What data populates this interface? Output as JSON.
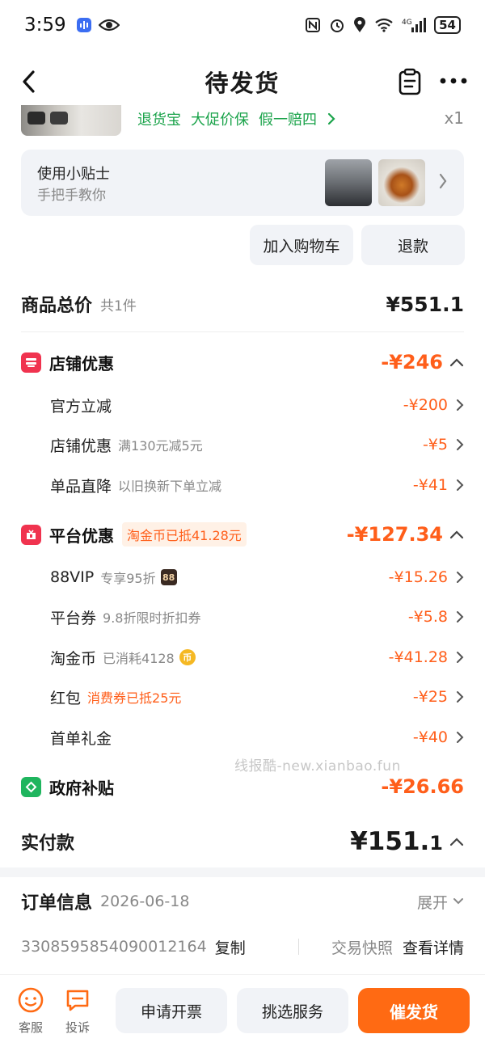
{
  "status_bar": {
    "time": "3:59",
    "network": "4G",
    "battery": "54"
  },
  "nav": {
    "title": "待发货"
  },
  "product": {
    "services": [
      "退货宝",
      "大促价保",
      "假一赔四"
    ],
    "quantity": "x1"
  },
  "tips": {
    "title": "使用小贴士",
    "subtitle": "手把手教你"
  },
  "actions": {
    "add_to_cart": "加入购物车",
    "refund": "退款"
  },
  "total": {
    "label": "商品总价",
    "count": "共1件",
    "price": "¥551.1"
  },
  "store_discount": {
    "label": "店铺优惠",
    "amount": "-¥246",
    "items": [
      {
        "label": "官方立减",
        "note": "",
        "amount": "-¥200"
      },
      {
        "label": "店铺优惠",
        "note": "满130元减5元",
        "amount": "-¥5"
      },
      {
        "label": "单品直降",
        "note": "以旧换新下单立减",
        "amount": "-¥41"
      }
    ]
  },
  "platform_discount": {
    "label": "平台优惠",
    "tag": "淘金币已抵41.28元",
    "amount": "-¥127.34",
    "items": [
      {
        "label": "88VIP",
        "note": "专享95折",
        "badge": "88",
        "amount": "-¥15.26"
      },
      {
        "label": "平台券",
        "note": "9.8折限时折扣券",
        "amount": "-¥5.8"
      },
      {
        "label": "淘金币",
        "note": "已消耗4128",
        "badge": "币",
        "amount": "-¥41.28"
      },
      {
        "label": "红包",
        "note": "消费券已抵25元",
        "amount": "-¥25"
      },
      {
        "label": "首单礼金",
        "note": "",
        "amount": "-¥40"
      }
    ]
  },
  "watermark": "线报酷-new.xianbao.fun",
  "gov_subsidy": {
    "label": "政府补贴",
    "amount": "-¥26.66"
  },
  "paid": {
    "label": "实付款",
    "amount_main": "¥151.",
    "amount_small": "1"
  },
  "order": {
    "title": "订单信息",
    "date": "2026-06-18",
    "expand": "展开",
    "number": "3308595854090012164",
    "copy": "复制",
    "snapshot": "交易快照",
    "details": "查看详情"
  },
  "bottom": {
    "service": "客服",
    "complain": "投诉",
    "invoice": "申请开票",
    "select_service": "挑选服务",
    "urge": "催发货"
  },
  "colors": {
    "accent": "#ff5e1a",
    "button_orange": "#ff6a13",
    "green_service": "#1aa34a",
    "store_icon": "#f0334f",
    "gov_icon": "#1fb55e"
  }
}
